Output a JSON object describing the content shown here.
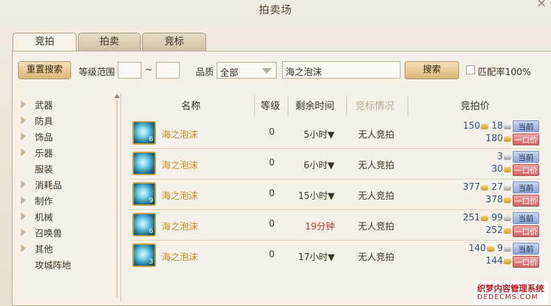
{
  "window": {
    "title": "拍卖场",
    "close": "×"
  },
  "tabs": [
    {
      "label": "竞拍"
    },
    {
      "label": "拍卖"
    },
    {
      "label": "竞标"
    }
  ],
  "toolbar": {
    "reset": "重置搜索",
    "level_label": "等级范围",
    "level_min": "",
    "level_max": "",
    "tilde": "~",
    "quality_label": "品质",
    "quality_value": "全部",
    "search_value": "海之泡沫",
    "search": "搜索",
    "match_label": "匹配率100%"
  },
  "sidebar": [
    "武器",
    "防具",
    "饰品",
    "乐器",
    "服装",
    "消耗品",
    "制作",
    "机械",
    "召唤兽",
    "其他",
    "攻城阵地"
  ],
  "columns": {
    "name": "名称",
    "level": "等级",
    "time": "剩余时间",
    "bid_status": "竞标情况",
    "price": "竞拍价"
  },
  "rows": [
    {
      "count": "6",
      "name": "海之泡沫",
      "level": "0",
      "time": "5小时▼",
      "status": "无人竞拍",
      "cur_gold": "150",
      "cur_silver": "18",
      "buy_gold": "180",
      "cur_btn": "当前",
      "buy_btn": "一口价"
    },
    {
      "count": "",
      "name": "海之泡沫",
      "level": "0",
      "time": "6小时▼",
      "status": "无人竞拍",
      "cur_gold": "",
      "cur_silver": "3",
      "buy_gold": "30",
      "cur_btn": "当前",
      "buy_btn": "一口价"
    },
    {
      "count": "9",
      "name": "海之泡沫",
      "level": "0",
      "time": "15小时▼",
      "status": "无人竞拍",
      "cur_gold": "377",
      "cur_silver": "27",
      "buy_gold": "378",
      "cur_btn": "当前",
      "buy_btn": "一口价"
    },
    {
      "count": "6",
      "name": "海之泡沫",
      "level": "0",
      "time": "19分钟",
      "status": "无人竞拍",
      "cur_gold": "251",
      "cur_silver": "99",
      "buy_gold": "252",
      "cur_btn": "当前",
      "buy_btn": "一口价"
    },
    {
      "count": "3",
      "name": "海之泡沫",
      "level": "0",
      "time": "17小时▼",
      "status": "无人竞拍",
      "cur_gold": "140",
      "cur_silver": "9",
      "buy_gold": "144",
      "cur_btn": "当前",
      "buy_btn": "一口价"
    }
  ],
  "watermark": {
    "line1": "织梦内容管理系统",
    "line2": "DEDECMS.COM"
  }
}
